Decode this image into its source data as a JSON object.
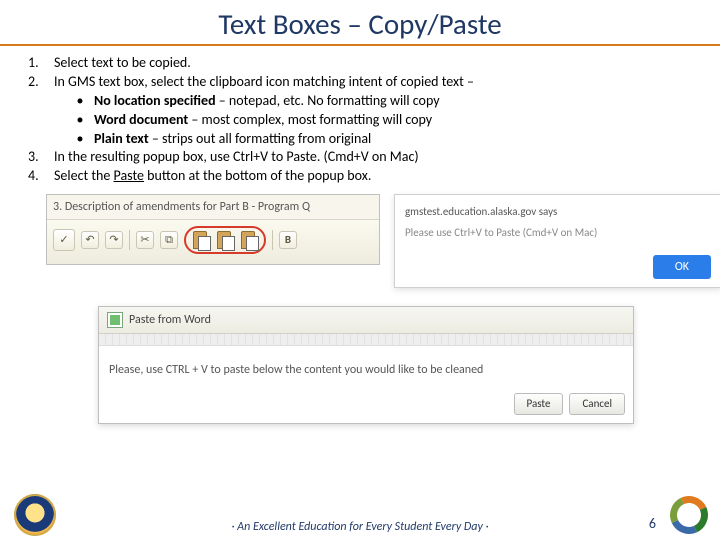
{
  "title": "Text Boxes – Copy/Paste",
  "steps": {
    "s1": {
      "n": "1.",
      "t": "Select text to be copied."
    },
    "s2": {
      "n": "2.",
      "t": "In GMS text box, select the clipboard icon matching intent of copied text –"
    },
    "s2a": {
      "bold": "No location specified",
      "rest": " – notepad, etc.  No formatting will copy"
    },
    "s2b": {
      "bold": "Word document",
      "rest": " – most complex, most formatting will copy"
    },
    "s2c": {
      "bold": "Plain text",
      "rest": " – strips out all formatting from original"
    },
    "s3": {
      "n": "3.",
      "t": "In the resulting popup box, use Ctrl+V to Paste. (Cmd+V on Mac)"
    },
    "s4": {
      "n": "4.",
      "pre": "Select the ",
      "u": "Paste",
      "post": " button at the bottom of the popup box."
    }
  },
  "shot1": {
    "caption": "3. Description of amendments for Part B - Program Q"
  },
  "shot2": {
    "title": "gmstest.education.alaska.gov says",
    "text": "Please use Ctrl+V to Paste (Cmd+V on Mac)",
    "ok": "OK"
  },
  "shot3": {
    "title": "Paste from Word",
    "body": "Please, use CTRL + V to paste below the content you would like to be cleaned",
    "paste": "Paste",
    "cancel": "Cancel"
  },
  "footer": "· An Excellent Education for Every Student Every Day ·",
  "page": "6"
}
